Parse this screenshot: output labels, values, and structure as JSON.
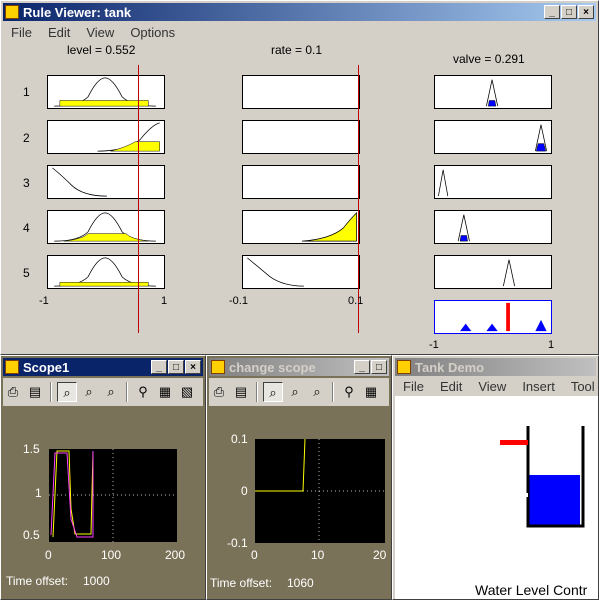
{
  "rule_viewer": {
    "title": "Rule Viewer: tank",
    "menu": [
      "File",
      "Edit",
      "View",
      "Options"
    ],
    "inputs": [
      {
        "label": "level = 0.552",
        "range": [
          "-1",
          "1"
        ]
      },
      {
        "label": "rate = 0.1",
        "range": [
          "-0.1",
          "0.1"
        ]
      }
    ],
    "output": {
      "label": "valve = 0.291",
      "range": [
        "-1",
        "1"
      ]
    },
    "rule_numbers": [
      "1",
      "2",
      "3",
      "4",
      "5"
    ],
    "colors": {
      "fill": "#ffff00",
      "output_fill": "#0000ff",
      "index_line": "#ff0000"
    }
  },
  "scope1": {
    "title": "Scope1",
    "y_ticks": [
      "1.5",
      "1",
      "0.5"
    ],
    "x_ticks": [
      "0",
      "100",
      "200"
    ],
    "time_offset_label": "Time offset:",
    "time_offset": "1000"
  },
  "change_scope": {
    "title": "change scope",
    "y_ticks": [
      "0.1",
      "0",
      "-0.1"
    ],
    "x_ticks": [
      "0",
      "10",
      "20"
    ],
    "time_offset_label": "Time offset:",
    "time_offset": "1060"
  },
  "tank_demo": {
    "title": "Tank Demo",
    "menu": [
      "File",
      "Edit",
      "View",
      "Insert",
      "Tool"
    ],
    "caption": "Water Level Contr",
    "colors": {
      "water": "#0000ff",
      "setpoint": "#ff0000"
    }
  },
  "window_buttons": {
    "minimize": "_",
    "maximize": "□",
    "close": "×"
  }
}
